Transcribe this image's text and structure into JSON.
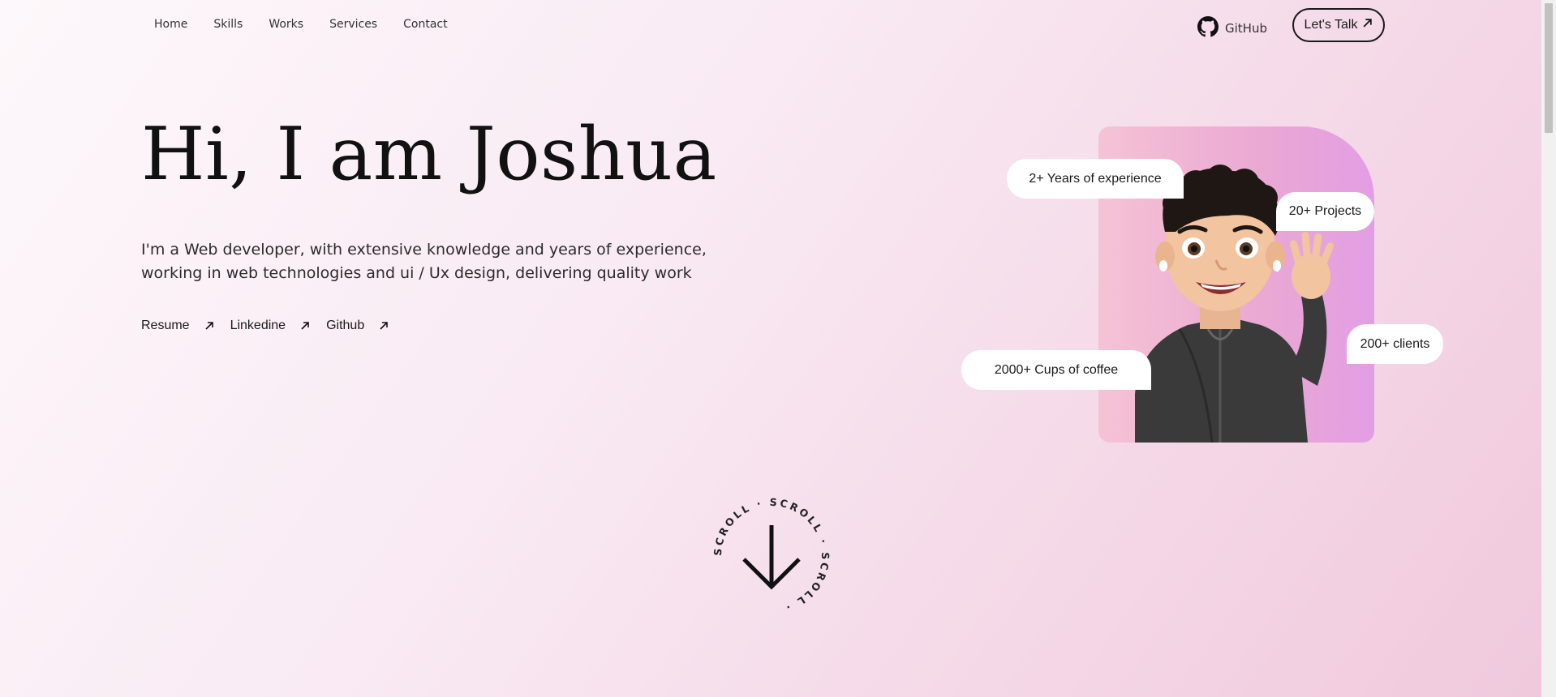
{
  "nav": {
    "items": [
      {
        "label": "Home"
      },
      {
        "label": "Skills"
      },
      {
        "label": "Works"
      },
      {
        "label": "Services"
      },
      {
        "label": "Contact"
      }
    ],
    "github_label": "GitHub",
    "cta_label": "Let's Talk"
  },
  "hero": {
    "title": "Hi, I am Joshua",
    "description": "I'm a Web developer, with extensive knowledge and years of experience, working in web technologies and ui / Ux design, delivering quality work",
    "links": [
      {
        "label": "Resume"
      },
      {
        "label": "Linkedine"
      },
      {
        "label": "Github"
      }
    ]
  },
  "profile": {
    "badges": {
      "experience": "2+ Years of experience",
      "projects": "20+ Projects",
      "clients": "200+ clients",
      "coffee": "2000+ Cups of coffee"
    }
  },
  "scroll": {
    "ring_text": "SCROLL · SCROLL · SCROLL · "
  }
}
